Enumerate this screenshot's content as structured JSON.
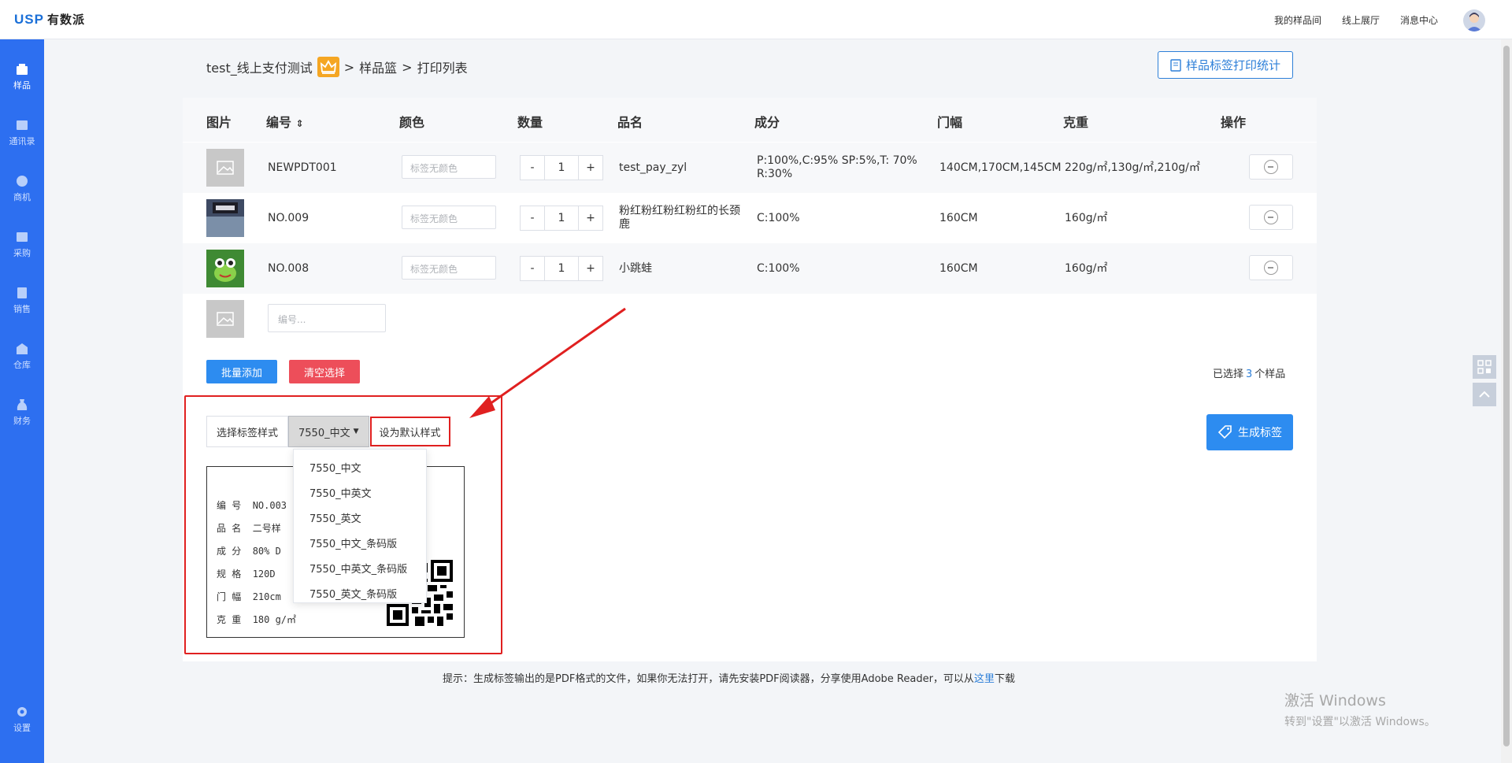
{
  "app": {
    "logo_en": "USP",
    "logo_cn": "有数派"
  },
  "top_nav": [
    "我的样品间",
    "线上展厅",
    "消息中心"
  ],
  "sidebar": {
    "items": [
      {
        "label": "样品",
        "icon": "sample-icon"
      },
      {
        "label": "通讯录",
        "icon": "contacts-icon"
      },
      {
        "label": "商机",
        "icon": "opportunity-icon"
      },
      {
        "label": "采购",
        "icon": "purchase-icon"
      },
      {
        "label": "销售",
        "icon": "sales-icon"
      },
      {
        "label": "仓库",
        "icon": "warehouse-icon"
      },
      {
        "label": "财务",
        "icon": "finance-icon"
      }
    ],
    "settings": "设置"
  },
  "breadcrumb": {
    "root": "test_线上支付测试",
    "sep": ">",
    "level1": "样品篮",
    "level2": "打印列表"
  },
  "stat_button": "样品标签打印统计",
  "table": {
    "headers": [
      "图片",
      "编号",
      "颜色",
      "数量",
      "品名",
      "成分",
      "门幅",
      "克重",
      "操作"
    ],
    "color_placeholder": "标签无颜色",
    "rows": [
      {
        "code": "NEWPDT001",
        "qty": "1",
        "name": "test_pay_zyl",
        "composition": "P:100%,C:95% SP:5%,T: 70% R:30%",
        "width": "140CM,170CM,145CM",
        "weight": "220g/㎡,130g/㎡,210g/㎡"
      },
      {
        "code": "NO.009",
        "qty": "1",
        "name": "粉红粉红粉红粉红的长颈鹿",
        "composition": "C:100%",
        "width": "160CM",
        "weight": "160g/㎡"
      },
      {
        "code": "NO.008",
        "qty": "1",
        "name": "小跳蛙",
        "composition": "C:100%",
        "width": "160CM",
        "weight": "160g/㎡"
      }
    ],
    "stepper_minus": "-",
    "stepper_plus": "+",
    "code_placeholder": "编号..."
  },
  "actions": {
    "batch_add": "批量添加",
    "clear": "清空选择"
  },
  "selected": {
    "prefix": "已选择",
    "count": "3",
    "suffix": "个样品"
  },
  "label_style": {
    "label": "选择标签样式",
    "current": "7550_中文",
    "set_default": "设为默认样式",
    "options": [
      "7550_中文",
      "7550_中英文",
      "7550_英文",
      "7550_中文_条码版",
      "7550_中英文_条码版",
      "7550_英文_条码版"
    ]
  },
  "generate_button": "生成标签",
  "label_preview": {
    "lines": [
      {
        "key": "编 号",
        "value": "NO.003"
      },
      {
        "key": "品 名",
        "value": "二号样"
      },
      {
        "key": "成 分",
        "value": "80% D"
      },
      {
        "key": "规 格",
        "value": "120D"
      },
      {
        "key": "门 幅",
        "value": "210cm"
      },
      {
        "key": "克 重",
        "value": "180 g/㎡"
      }
    ]
  },
  "tip": {
    "text": "提示：生成标签输出的是PDF格式的文件，如果你无法打开，请先安装PDF阅读器，分享使用Adobe Reader，可以从",
    "link": "这里",
    "after": "下载"
  },
  "watermark": {
    "line1": "激活 Windows",
    "line2": "转到\"设置\"以激活 Windows。"
  },
  "colors": {
    "sidebar": "#2d6ff0",
    "primary": "#2d8cf0",
    "danger": "#ed4e5a",
    "highlight": "#e02020"
  }
}
